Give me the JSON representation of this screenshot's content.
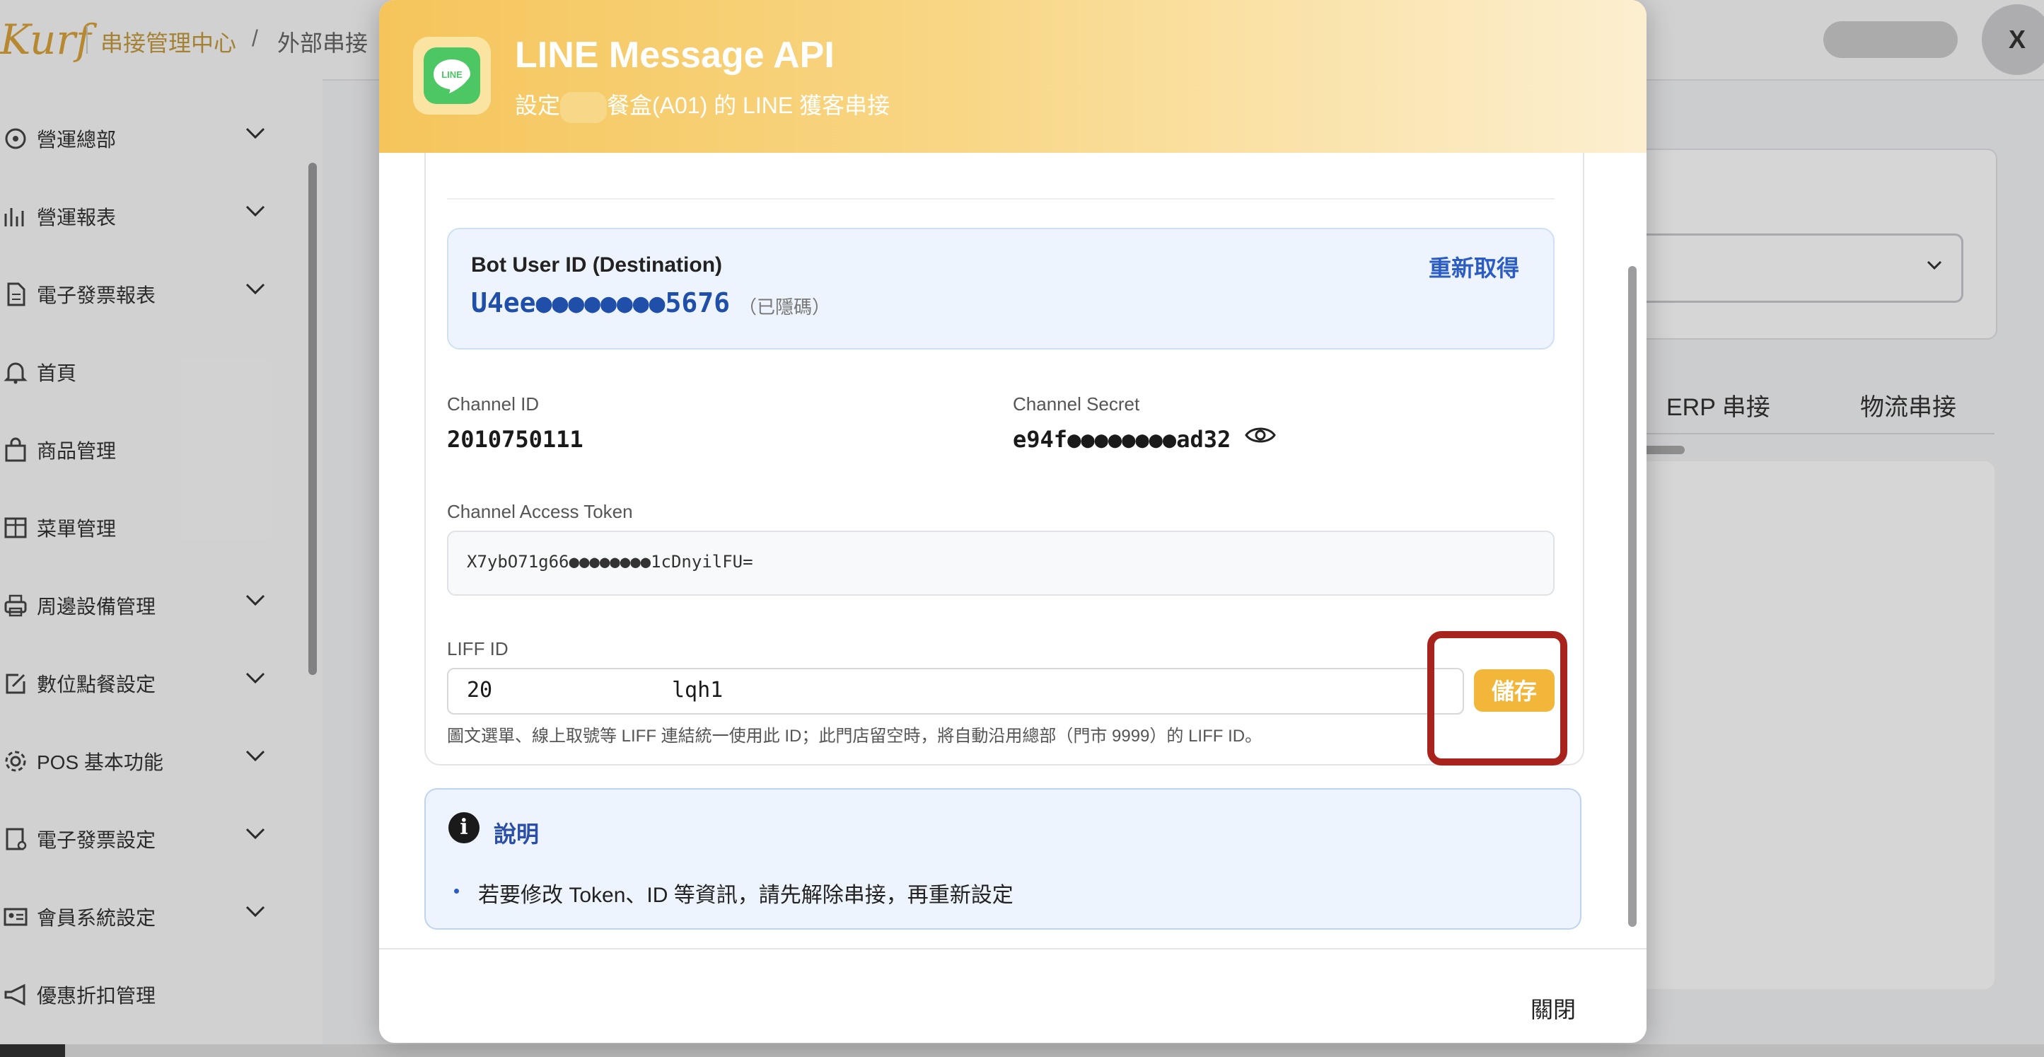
{
  "header": {
    "logo_text": "Kurf",
    "breadcrumb": [
      "串接管理中心",
      "/",
      "外部串接"
    ],
    "close_label": "X"
  },
  "sidebar": {
    "items": [
      {
        "label": "營運總部",
        "icon": "target-icon",
        "expandable": true
      },
      {
        "label": "營運報表",
        "icon": "chart-icon",
        "expandable": true
      },
      {
        "label": "電子發票報表",
        "icon": "document-icon",
        "expandable": true
      },
      {
        "label": "首頁",
        "icon": "bell-icon",
        "expandable": false
      },
      {
        "label": "商品管理",
        "icon": "bag-icon",
        "expandable": false
      },
      {
        "label": "菜單管理",
        "icon": "table-icon",
        "expandable": false
      },
      {
        "label": "周邊設備管理",
        "icon": "printer-icon",
        "expandable": true
      },
      {
        "label": "數位點餐設定",
        "icon": "edit-icon",
        "expandable": true
      },
      {
        "label": "POS 基本功能",
        "icon": "gear-icon",
        "expandable": true
      },
      {
        "label": "電子發票設定",
        "icon": "invoice-icon",
        "expandable": true
      },
      {
        "label": "會員系統設定",
        "icon": "id-card-icon",
        "expandable": true
      },
      {
        "label": "優惠折扣管理",
        "icon": "megaphone-icon",
        "expandable": false
      }
    ]
  },
  "background": {
    "tabs": [
      "ERP 串接",
      "物流串接"
    ]
  },
  "modal": {
    "title": "LINE Message API",
    "subtitle_prefix": "設定",
    "subtitle_suffix": "餐盒(A01) 的 LINE 獲客串接",
    "app_icon_text": "LINE",
    "bot": {
      "label": "Bot User ID (Destination)",
      "value": "U4ee●●●●●●●●5676",
      "masked_note": "（已隱碼）",
      "refetch_label": "重新取得"
    },
    "channel_id": {
      "label": "Channel ID",
      "value": "2010750111"
    },
    "channel_secret": {
      "label": "Channel Secret",
      "value": "e94f●●●●●●●●ad32"
    },
    "access_token": {
      "label": "Channel Access Token",
      "value": "X7ybO71g66●●●●●●●●1cDnyilFU="
    },
    "liff": {
      "label": "LIFF ID",
      "value_start": "20",
      "value_end": "lqh1",
      "save_label": "儲存",
      "hint": "圖文選單、線上取號等 LIFF 連結統一使用此 ID；此門店留空時，將自動沿用總部（門市 9999）的 LIFF ID。"
    },
    "info": {
      "title": "說明",
      "items": [
        "若要修改 Token、ID 等資訊，請先解除串接，再重新設定"
      ]
    },
    "close_label": "關閉"
  },
  "colors": {
    "brand": "#d9a23a",
    "header_gradient_start": "#f5c55b",
    "link_blue": "#2b5cc4",
    "save_button": "#f2b63a",
    "highlight_red": "#a8231c"
  }
}
